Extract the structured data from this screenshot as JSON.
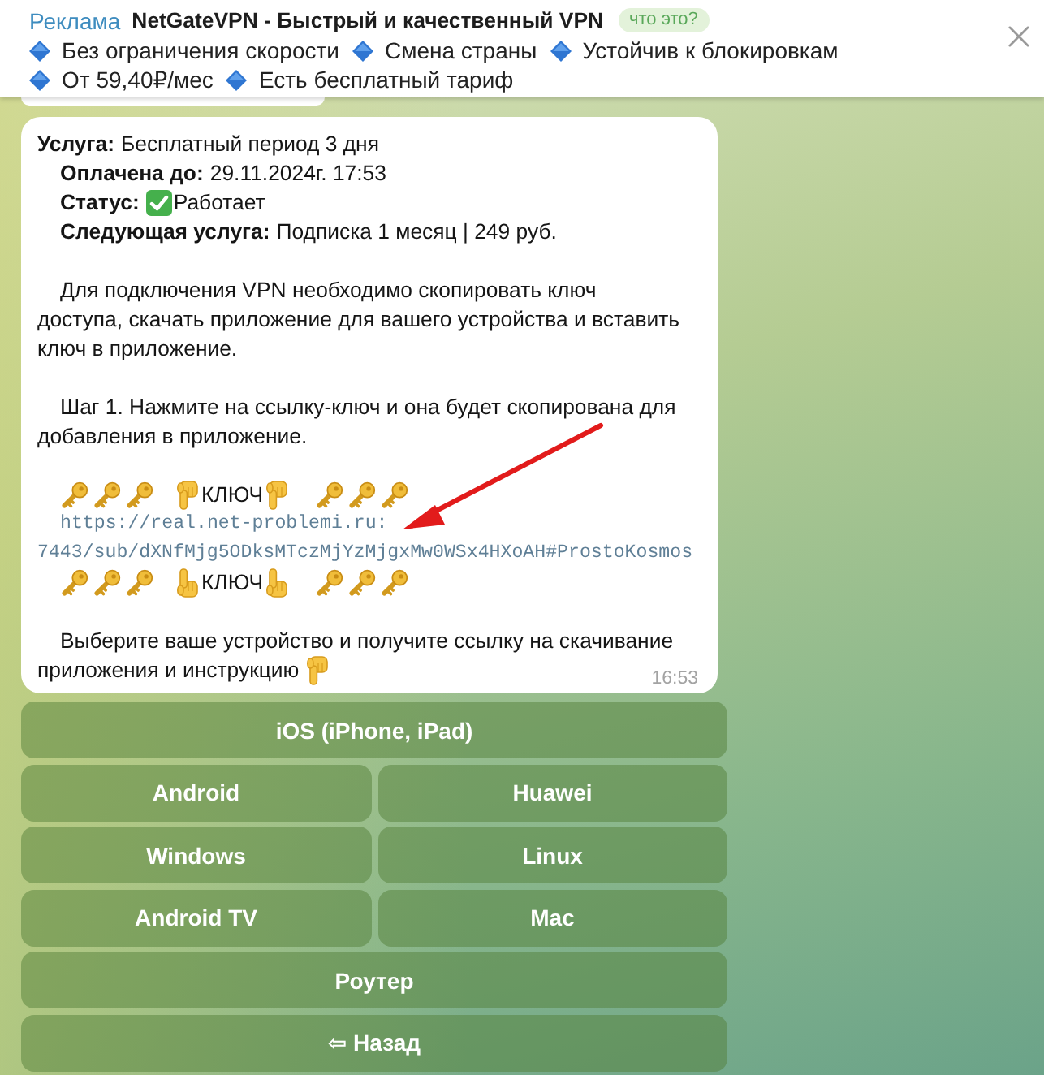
{
  "ad": {
    "label": "Реклама",
    "title": "NetGateVPN - Быстрый и качественный VPN",
    "badge": "что это?",
    "features": [
      "Без ограничения скорости",
      "Смена страны",
      "Устойчив к блокировкам",
      "От 59,40₽/мес",
      "Есть бесплатный тариф"
    ]
  },
  "message": {
    "fields": [
      {
        "kind": "text",
        "label": "Услуга:",
        "value": "Бесплатный период 3 дня"
      },
      {
        "kind": "text",
        "label": "Оплачена до:",
        "value": "29.11.2024г. 17:53"
      },
      {
        "kind": "status",
        "label": "Статус:",
        "value": "Работает"
      },
      {
        "kind": "text",
        "label": "Следующая услуга:",
        "value": "Подписка 1 месяц | 249 руб."
      }
    ],
    "sections": [
      [
        {
          "kind": "text",
          "text": "Для подключения VPN необходимо скопировать ключ доступа, скачать приложение для вашего устройства и вставить ключ в приложение.",
          "hand_down": false
        }
      ],
      [
        {
          "kind": "text",
          "text": "Шаг 1. Нажмите на ссылку-ключ и она будет скопирована для добавления в приложение.",
          "hand_down": false
        }
      ],
      [
        {
          "kind": "keys",
          "label": "КЛЮЧ",
          "hand_down": true
        },
        {
          "kind": "link",
          "lines": [
            "https://real.net-problemi.ru:",
            "7443/sub/dXNfMjg5ODksMTczMjYzMjgxMw0WSx4HXoAH#ProstoKosmos"
          ]
        },
        {
          "kind": "keys",
          "label": "КЛЮЧ",
          "hand_up": true
        }
      ],
      [
        {
          "kind": "lines",
          "lines": [
            "Выберите ваше устройство и получите ссылку на скачивание",
            "приложения и инструкцию"
          ],
          "hand_down": true
        }
      ]
    ],
    "time": "16:53"
  },
  "keyboard": {
    "rows": [
      [
        "iOS (iPhone, iPad)"
      ],
      [
        "Android",
        "Huawei"
      ],
      [
        "Windows",
        "Linux"
      ],
      [
        "Android TV",
        "Mac"
      ],
      [
        "Роутер"
      ],
      [
        "⇦ Назад"
      ]
    ]
  }
}
